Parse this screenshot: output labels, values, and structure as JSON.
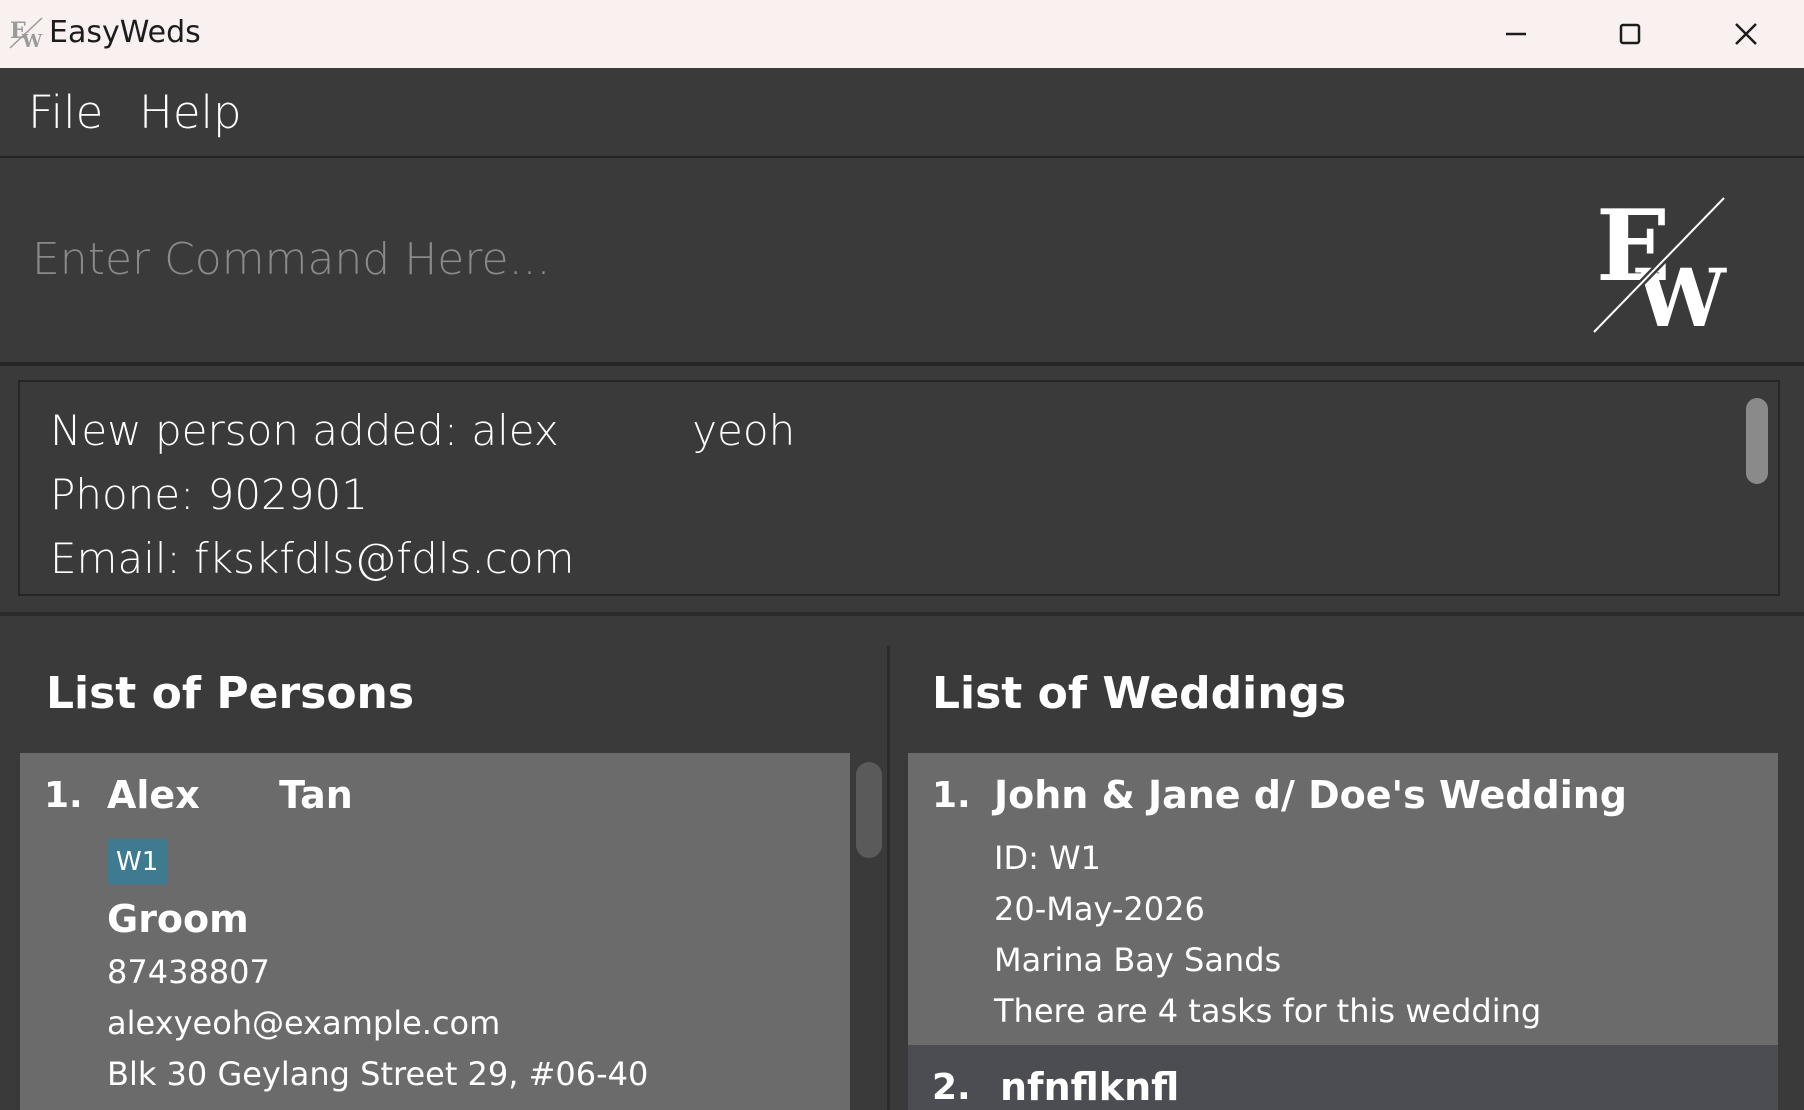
{
  "window": {
    "title": "EasyWeds",
    "controls": [
      "minimize-icon",
      "maximize-icon",
      "close-icon"
    ]
  },
  "menu": {
    "file_label": "File",
    "help_label": "Help"
  },
  "command": {
    "placeholder": "Enter Command Here...",
    "value": ""
  },
  "logo": {
    "text_e": "E",
    "text_w": "W"
  },
  "result": {
    "line1": "New person added: alex          yeoh",
    "line2": "Phone: 902901",
    "line3": "Email: fkskfdls@fdls.com"
  },
  "persons_panel": {
    "title": "List of Persons",
    "items": [
      {
        "index": "1.",
        "name": "Alex      Tan",
        "tag": "W1",
        "role": "Groom",
        "phone": "87438807",
        "email": "alexyeoh@example.com",
        "address": "Blk 30 Geylang Street 29, #06-40"
      }
    ]
  },
  "weddings_panel": {
    "title": "List of Weddings",
    "items": [
      {
        "index": "1.",
        "name": "John & Jane d/ Doe's Wedding",
        "id": "ID: W1",
        "date": "20-May-2026",
        "venue": "Marina Bay Sands",
        "tasks": "There are 4 tasks for this wedding"
      },
      {
        "index": "2.",
        "name": "nfnflknfl"
      }
    ]
  },
  "colors": {
    "titlebar": "#f8f1ef",
    "background": "#3a3a3a",
    "card": "#6b6b6b",
    "card_alt": "#4b4d52",
    "tag": "#3e7b91"
  }
}
